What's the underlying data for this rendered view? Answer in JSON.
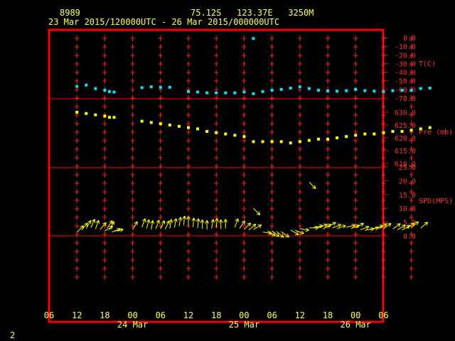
{
  "header": {
    "station": "8989",
    "location": "75.12S   123.37E   3250M",
    "period": "23 Mar 2015/120000UTC - 26 Mar 2015/000000UTC",
    "page_number": "2"
  },
  "colors": {
    "frame": "#ff0000",
    "grid": "#ff2020",
    "axis_text": "#ff3030",
    "header_text": "#ffff55",
    "temperature": "#00e5ff",
    "pressure": "#ffff00",
    "wind": "#ffff00"
  },
  "chart_data": [
    {
      "type": "scatter",
      "panel": "temperature",
      "ylabel": "T(C)",
      "ylim": [
        -70.0,
        0.0
      ],
      "yticks": [
        "0.0",
        "-10.0",
        "-20.0",
        "-30.0",
        "-40.0",
        "-50.0",
        "-60.0",
        "-70.0"
      ],
      "series": [
        {
          "x_hours": [
            12,
            14,
            16,
            18,
            19,
            20,
            26,
            28,
            30,
            32,
            36,
            38,
            40,
            42,
            44,
            46,
            48,
            50,
            52,
            54,
            56,
            58,
            60,
            62,
            64,
            66,
            68,
            70,
            72,
            74,
            76,
            78,
            80,
            82,
            84,
            86,
            88
          ],
          "values": [
            -56.5,
            -55.0,
            -59.0,
            -61.0,
            -62.5,
            -63.0,
            -58.0,
            -57.0,
            -57.5,
            -57.5,
            -62.5,
            -63.0,
            -64.0,
            -64.0,
            -64.0,
            -64.0,
            -63.0,
            -65.0,
            -62.5,
            -61.0,
            -60.0,
            -58.5,
            -57.0,
            -59.0,
            -61.0,
            -62.0,
            -62.0,
            -61.5,
            -60.0,
            -61.5,
            -62.0,
            -62.5,
            -61.5,
            -61.0,
            -61.0,
            -59.0,
            -58.5
          ]
        }
      ],
      "outlier": {
        "x_hour": 50,
        "value": -1.0
      }
    },
    {
      "type": "scatter",
      "panel": "pressure",
      "ylabel": "Pre (mb)",
      "ylim": [
        610.0,
        630.0
      ],
      "yticks": [
        "630.0",
        "625.0",
        "620.0",
        "615.0",
        "610.0"
      ],
      "series": [
        {
          "x_hours": [
            12,
            14,
            16,
            18,
            19,
            20,
            26,
            28,
            30,
            32,
            34,
            36,
            38,
            40,
            42,
            44,
            46,
            48,
            50,
            52,
            54,
            56,
            58,
            60,
            62,
            64,
            66,
            68,
            70,
            72,
            74,
            76,
            78,
            80,
            82,
            84,
            86,
            88
          ],
          "values": [
            630.0,
            629.5,
            629.0,
            628.5,
            628.0,
            628.0,
            626.5,
            626.0,
            625.5,
            625.0,
            624.5,
            624.0,
            623.5,
            622.5,
            622.0,
            621.5,
            621.0,
            620.5,
            618.5,
            618.5,
            618.5,
            618.5,
            618.0,
            618.5,
            619.0,
            619.5,
            619.5,
            620.0,
            620.5,
            621.0,
            621.5,
            621.5,
            622.0,
            622.5,
            622.5,
            623.0,
            623.5,
            624.0
          ]
        }
      ]
    },
    {
      "type": "scatter",
      "panel": "wind",
      "ylabel": "SPD(MPS)",
      "ylim": [
        0.0,
        25.0
      ],
      "yticks": [
        "25.0",
        "20.0",
        "15.0",
        "10.0",
        "5.0",
        "0.0"
      ],
      "series": [
        {
          "x_hours": [
            12,
            13,
            14,
            15,
            16,
            17,
            18,
            18.5,
            19,
            19.5,
            20,
            24,
            26,
            27,
            28,
            29,
            30,
            31,
            32,
            33,
            34,
            35,
            36,
            37,
            38,
            39,
            40,
            41,
            42,
            43,
            44,
            46,
            47,
            48,
            49,
            50,
            52,
            53,
            54,
            55,
            56,
            58,
            59,
            60,
            62,
            63,
            64,
            65,
            66,
            67,
            68,
            70,
            71,
            72,
            73,
            74,
            75,
            76,
            77,
            78,
            80,
            81,
            82,
            83,
            84,
            86
          ],
          "values": [
            2.8,
            3.6,
            4.2,
            4.5,
            4.0,
            3.8,
            3.3,
            4.3,
            3.8,
            2.9,
            3.2,
            3.8,
            4.6,
            4.2,
            3.8,
            4.1,
            4.0,
            3.9,
            4.2,
            4.5,
            5.0,
            5.4,
            5.2,
            4.7,
            4.4,
            4.0,
            3.8,
            4.2,
            4.5,
            4.0,
            4.2,
            4.6,
            4.2,
            3.8,
            3.6,
            3.8,
            2.9,
            3.2,
            3.4,
            3.1,
            3.0,
            3.6,
            3.5,
            4.1,
            4.4,
            4.6,
            4.5,
            4.0,
            4.7,
            4.4,
            4.1,
            4.6,
            4.2,
            4.4,
            3.7,
            3.5,
            3.9,
            4.3,
            4.2,
            4.1,
            4.0,
            3.7,
            3.6,
            4.2,
            4.5,
            4.3
          ],
          "directions_deg": [
            45,
            40,
            30,
            25,
            20,
            40,
            60,
            35,
            30,
            70,
            80,
            30,
            20,
            15,
            10,
            20,
            25,
            25,
            10,
            10,
            10,
            5,
            0,
            5,
            5,
            0,
            0,
            10,
            5,
            0,
            0,
            20,
            35,
            45,
            50,
            60,
            100,
            120,
            130,
            130,
            125,
            120,
            110,
            100,
            90,
            80,
            70,
            60,
            60,
            70,
            70,
            75,
            70,
            60,
            70,
            80,
            80,
            75,
            60,
            55,
            55,
            60,
            60,
            55,
            50,
            50
          ]
        }
      ],
      "outliers": [
        {
          "x_hour": 50,
          "value": 11.5,
          "direction_deg": 315
        },
        {
          "x_hour": 62,
          "value": 21.0,
          "direction_deg": 315
        }
      ]
    }
  ],
  "x_axis": {
    "hour_ticks": [
      "06",
      "12",
      "18",
      "00",
      "06",
      "12",
      "18",
      "00",
      "06",
      "12",
      "18",
      "00",
      "06"
    ],
    "date_labels": [
      "24 Mar",
      "25 Mar",
      "26 Mar"
    ]
  }
}
